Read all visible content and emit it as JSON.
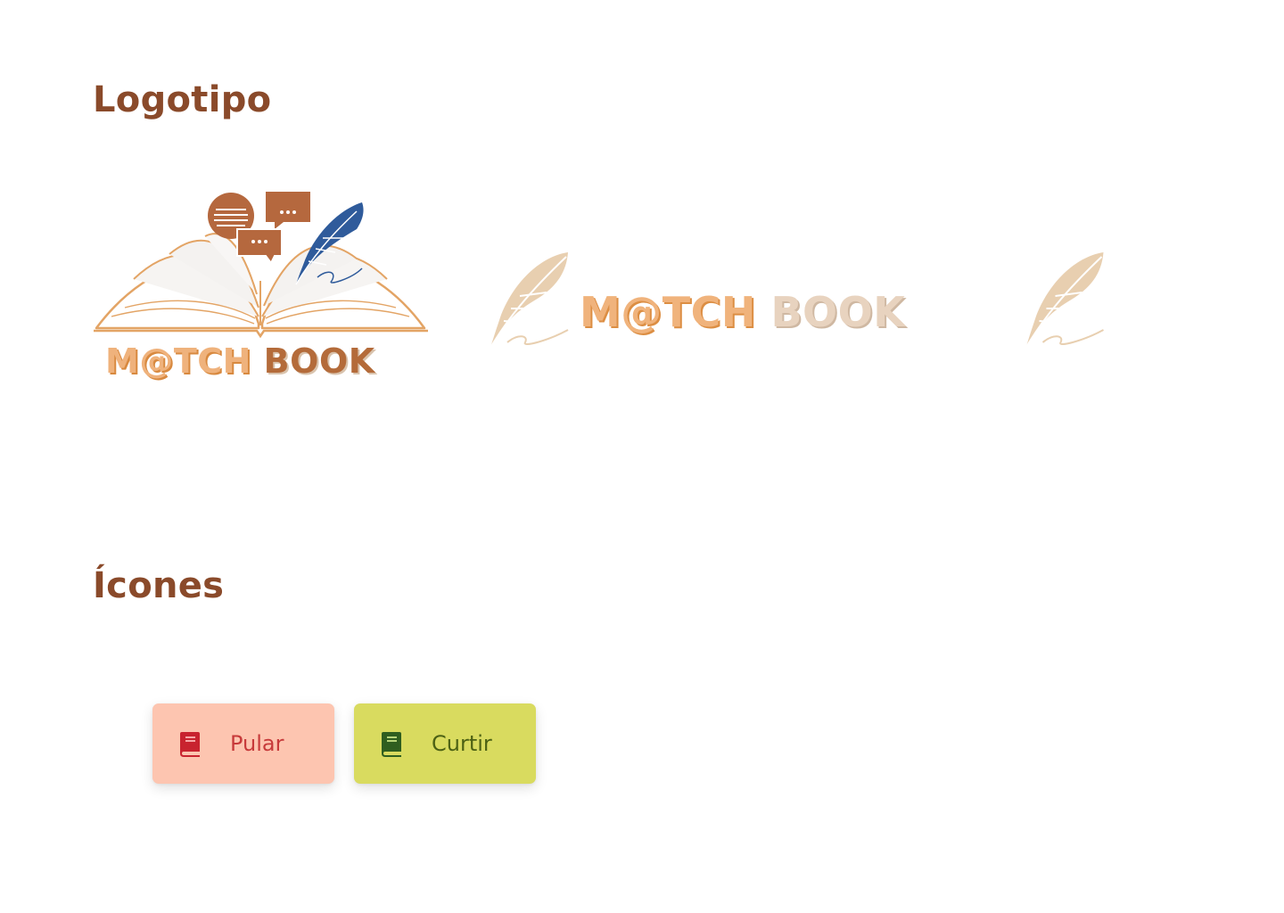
{
  "sections": {
    "logos": {
      "title": "Logotipo"
    },
    "icons": {
      "title": "Ícones"
    }
  },
  "logos": {
    "main": {
      "wordmark_a": "M@TCH",
      "wordmark_b": "BOOK"
    },
    "horizontal": {
      "wordmark_a": "M@TCH",
      "wordmark_b": "BOOK"
    },
    "symbol": {
      "icon": "feather-icon"
    }
  },
  "buttons": {
    "skip": {
      "label": "Pular",
      "icon": "book-icon",
      "bg": "#fdc5b0",
      "color": "#c73a3a"
    },
    "like": {
      "label": "Curtir",
      "icon": "book-icon",
      "bg": "#d9db5f",
      "color": "#4c6114"
    }
  },
  "colors": {
    "heading": "#8a4a2a",
    "brand_orange": "#efb27c",
    "brand_brown": "#b46b3a",
    "brand_blue": "#2f5b9b",
    "brand_beige": "#e8d3bf"
  }
}
